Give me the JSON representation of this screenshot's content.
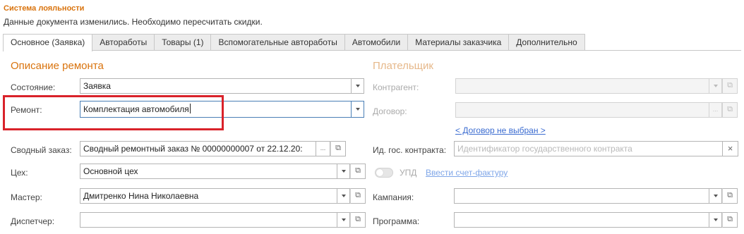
{
  "section": {
    "title": "Система лояльности",
    "notice": "Данные документа изменились. Необходимо пересчитать скидки."
  },
  "tabs": [
    {
      "label": "Основное (Заявка)"
    },
    {
      "label": "Автоработы"
    },
    {
      "label": "Товары (1)"
    },
    {
      "label": "Вспомогательные автоработы"
    },
    {
      "label": "Автомобили"
    },
    {
      "label": "Материалы заказчика"
    },
    {
      "label": "Дополнительно"
    }
  ],
  "left": {
    "group_title": "Описание ремонта",
    "state_label": "Состояние:",
    "state_value": "Заявка",
    "repair_label": "Ремонт:",
    "repair_value": "Комплектация автомобиля",
    "summary_label": "Сводный заказ:",
    "summary_value": "Сводный ремонтный заказ № 00000000007 от 22.12.20:",
    "shop_label": "Цех:",
    "shop_value": "Основной цех",
    "master_label": "Мастер:",
    "master_value": "Дмитренко Нина Николаевна",
    "dispatcher_label": "Диспетчер:",
    "dispatcher_value": ""
  },
  "right": {
    "group_title": "Плательщик",
    "contractor_label": "Контрагент:",
    "contractor_value": "",
    "contract_label": "Договор:",
    "contract_value": "",
    "contract_link": "< Договор не выбран >",
    "gov_label": "Ид. гос. контракта:",
    "gov_placeholder": "Идентификатор государственного контракта",
    "upd_label": "УПД",
    "invoice_link": "Ввести счет-фактуру",
    "campaign_label": "Кампания:",
    "campaign_value": "",
    "program_label": "Программа:",
    "program_value": ""
  },
  "icons": {
    "dropdown": "▾",
    "open": "⧉",
    "more": "...",
    "clear": "×"
  },
  "colors": {
    "accent": "#d9730d",
    "highlight": "#d9222a",
    "link": "#3a6bd0",
    "focus": "#4a7fb6"
  }
}
